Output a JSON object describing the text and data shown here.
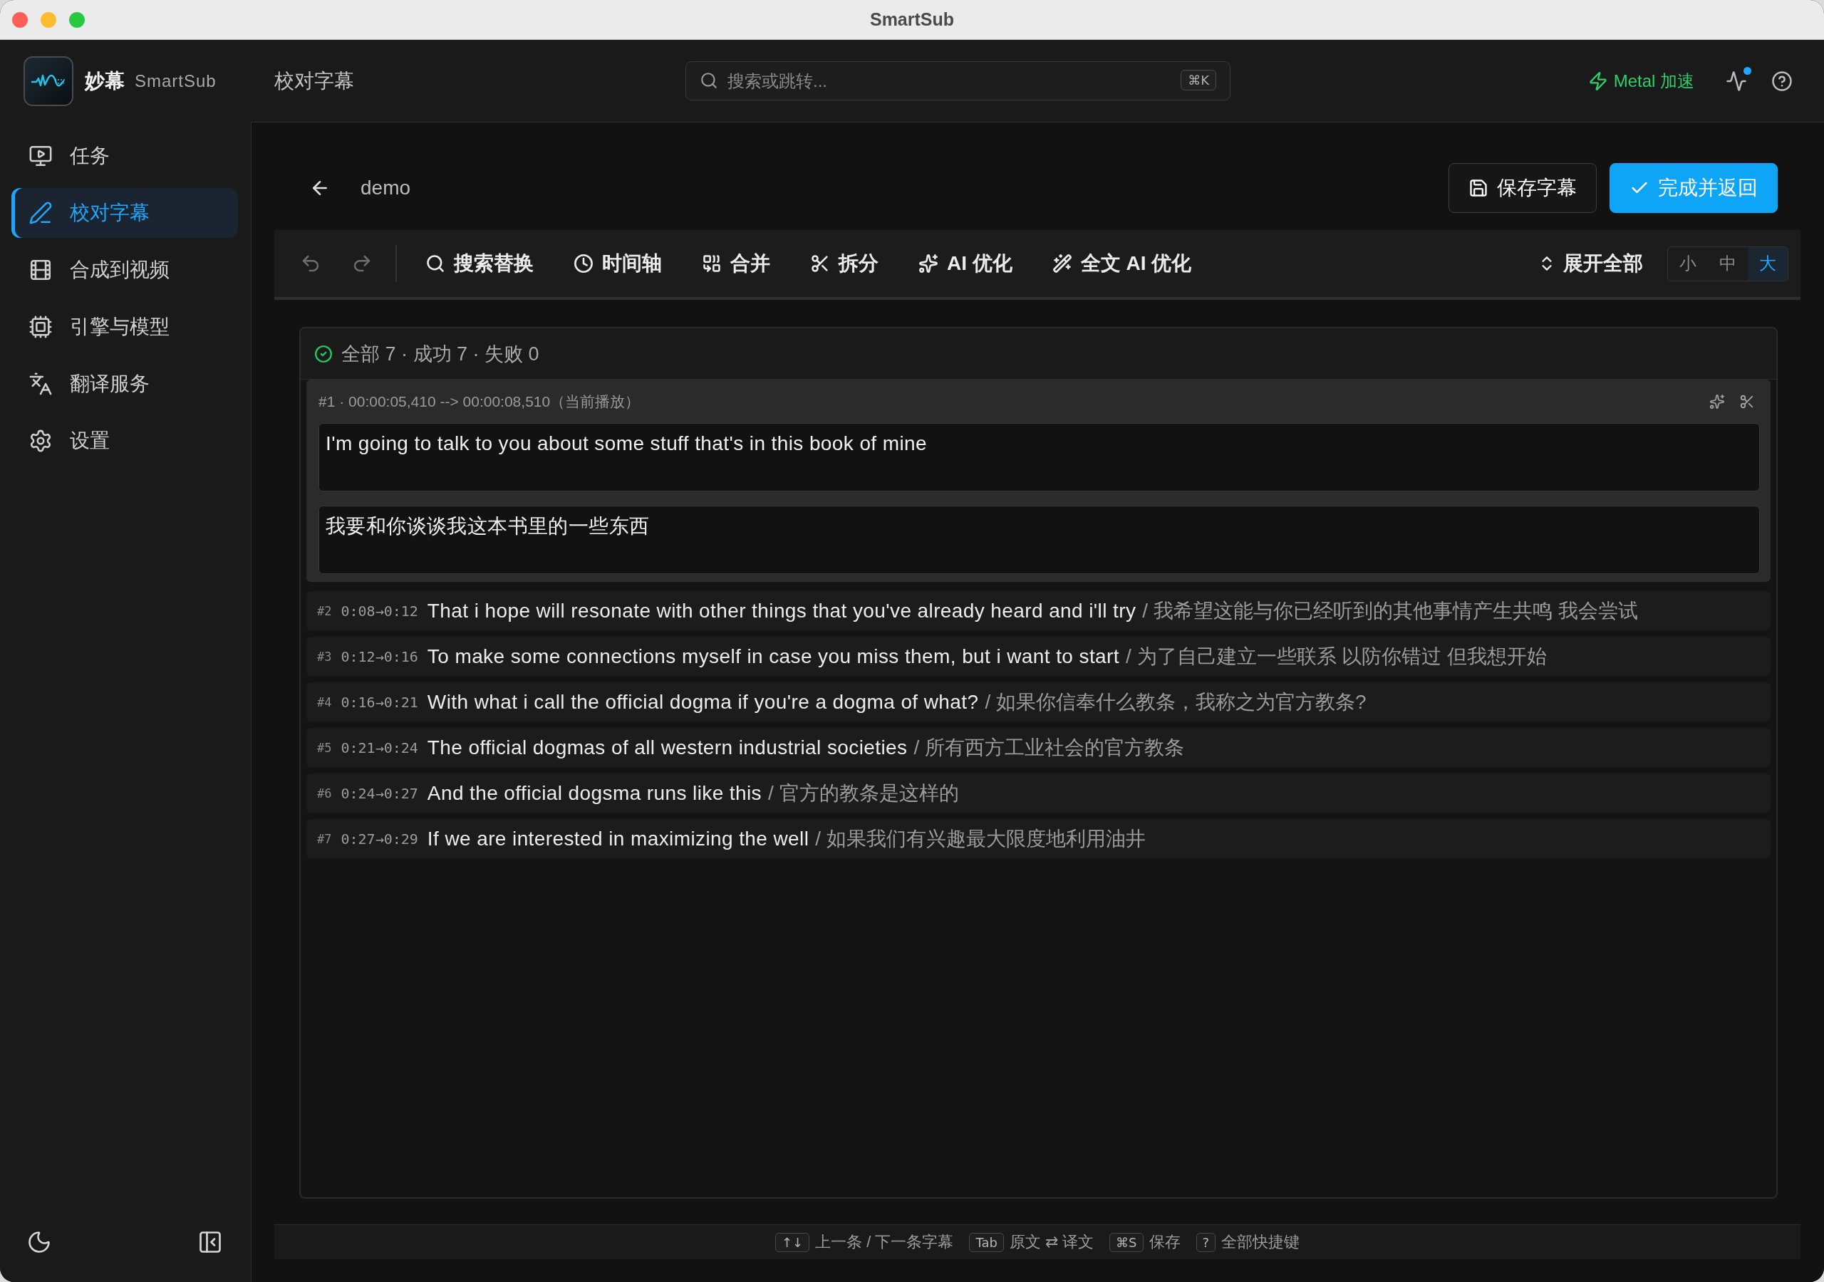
{
  "window": {
    "title": "SmartSub"
  },
  "header": {
    "brand": "妙幕",
    "brand_subtitle": "SmartSub",
    "page_title": "校对字幕",
    "search": {
      "placeholder": "搜索或跳转...",
      "shortcut": "⌘K"
    },
    "acceleration": "Metal 加速",
    "activity_alert": true
  },
  "sidebar": {
    "items": [
      {
        "label": "任务",
        "selected": false
      },
      {
        "label": "校对字幕",
        "selected": true
      },
      {
        "label": "合成到视频",
        "selected": false
      },
      {
        "label": "引擎与模型",
        "selected": false
      },
      {
        "label": "翻译服务",
        "selected": false
      },
      {
        "label": "设置",
        "selected": false
      }
    ]
  },
  "editor": {
    "file_name": "demo",
    "actions": [
      {
        "label": "保存字幕",
        "kind": "secondary"
      },
      {
        "label": "完成并返回",
        "kind": "primary"
      }
    ]
  },
  "toolbar": {
    "undo": {
      "disabled": true
    },
    "redo": {
      "disabled": true
    },
    "tools": [
      {
        "label": "搜索替换"
      },
      {
        "label": "时间轴"
      },
      {
        "label": "合并"
      },
      {
        "label": "拆分"
      },
      {
        "label": "AI 优化"
      },
      {
        "label": "全文 AI 优化"
      }
    ],
    "expand_all": "展开全部",
    "sizes": [
      {
        "label": "小",
        "selected": false
      },
      {
        "label": "中",
        "selected": false
      },
      {
        "label": "大",
        "selected": true
      }
    ]
  },
  "summary": {
    "text": "全部 7 · 成功 7 · 失败 0"
  },
  "subtitles": [
    {
      "expanded": true,
      "meta": "#1 · 00:00:05,410 --> 00:00:08,510（当前播放）",
      "source": "I'm going to talk to you about some stuff that's in this book of mine",
      "translation": "我要和你谈谈我这本书里的一些东西"
    },
    {
      "expanded": false,
      "index": "#2",
      "time": "0:08→0:12",
      "source": "That i hope will resonate with other things that you've already heard and i'll try",
      "translation": "/ 我希望这能与你已经听到的其他事情产生共鸣 我会尝试"
    },
    {
      "expanded": false,
      "index": "#3",
      "time": "0:12→0:16",
      "source": "To make some connections myself in case you miss them, but i want to start",
      "translation": "/ 为了自己建立一些联系 以防你错过 但我想开始"
    },
    {
      "expanded": false,
      "index": "#4",
      "time": "0:16→0:21",
      "source": "With what i call the official dogma if you're a dogma of what?",
      "translation": "/ 如果你信奉什么教条，我称之为官方教条?"
    },
    {
      "expanded": false,
      "index": "#5",
      "time": "0:21→0:24",
      "source": "The official dogmas of all western industrial societies",
      "translation": "/ 所有西方工业社会的官方教条"
    },
    {
      "expanded": false,
      "index": "#6",
      "time": "0:24→0:27",
      "source": "And the official dogsma runs like this",
      "translation": "/ 官方的教条是这样的"
    },
    {
      "expanded": false,
      "index": "#7",
      "time": "0:27→0:29",
      "source": "If we are interested in maximizing the well",
      "translation": "/ 如果我们有兴趣最大限度地利用油井"
    }
  ],
  "shortcuts": [
    {
      "key": "↑↓",
      "label": "上一条 / 下一条字幕"
    },
    {
      "key": "Tab",
      "label": "原文 ⇄ 译文"
    },
    {
      "key": "⌘S",
      "label": "保存"
    },
    {
      "key": "?",
      "label": "全部快捷键"
    }
  ]
}
